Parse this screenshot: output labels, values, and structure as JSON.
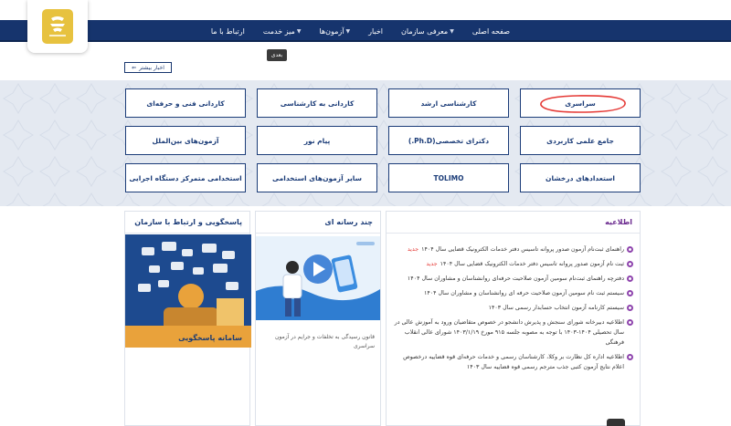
{
  "nav": {
    "items": [
      {
        "label": "صفحه اصلی",
        "dropdown": false
      },
      {
        "label": "معرفی سازمان",
        "dropdown": true
      },
      {
        "label": "اخبار",
        "dropdown": false
      },
      {
        "label": "آزمون‌ها",
        "dropdown": true
      },
      {
        "label": "میز خدمت",
        "dropdown": true
      },
      {
        "label": "ارتباط با ما",
        "dropdown": false
      }
    ]
  },
  "slider": {
    "next_label": "بعدی"
  },
  "news": {
    "more_label": "اخبار بیشتر"
  },
  "exams": [
    "سراسری",
    "کارشناسی ارشد",
    "کاردانی به کارشناسی",
    "کاردانی فنی و حرفه‌ای",
    "جامع علمی کاربردی",
    "دکترای تخصصی(Ph.D.)",
    "پیام نور",
    "آزمون‌های بین‌الملل",
    "استعدادهای درخشان",
    "TOLIMO",
    "سایر آزمون‌های استخدامی",
    "استخدامی متمرکز دستگاه اجرایی"
  ],
  "support": {
    "title": "پاسخگویی و ارتباط با سازمان",
    "image_label": "سامانه پاسخگویی"
  },
  "media": {
    "title": "چند رسانه ای",
    "caption": "قانون رسیدگی به تخلفات و جرایم در آزمون سراسری"
  },
  "notices": {
    "title": "اطلاعیه",
    "new_label": "جدید",
    "items": [
      {
        "text": "راهنمای ثبت‌نام آزمون صدور پروانه تاسیس دفتر خدمات الکترونیک قضایی سال ۱۴۰۴",
        "is_new": true
      },
      {
        "text": "ثبت نام آزمون صدور پروانه تاسیس دفتر خدمات الکترونیک قضایی سال ۱۴۰۴",
        "is_new": true
      },
      {
        "text": "دفترچه راهنمای ثبت‌نام سومین آزمون صلاحیت حرفه‌ای روانشناسان و مشاوران سال ۱۴۰۴",
        "is_new": false
      },
      {
        "text": "سیستم ثبت نام سومین آزمون صلاحیت حرفه ای روانشناسان و مشاوران سال ۱۴۰۴",
        "is_new": false
      },
      {
        "text": "سیستم کارنامه آزمون انتخاب حسابدار رسمی سال ۱۴۰۳",
        "is_new": false
      },
      {
        "text": "اطلاعیه دبیرخانه شورای سنجش و پذیرش دانشجو در خصوص متقاضیان ورود به آموزش عالی در سال تحصیلی ۱۴۰۴-۱۴۰۳ با توجه به مصوبه جلسه ۹۱۵ مورخ ۱۴۰۳/۱/۱۹ شورای عالی انقلاب فرهنگی",
        "is_new": false
      },
      {
        "text": "اطلاعیه اداره کل نظارت بر وکلا، کارشناسان رسمی و خدمات حرفه‌ای قوه قضاییه درخصوص اعلام نتایج آزمون کتبی جذب مترجم رسمی قوه قضاییه سال ۱۴۰۳",
        "is_new": false
      }
    ]
  },
  "colors": {
    "primary": "#16346d",
    "accent": "#8e44ad",
    "new_badge": "#e53935",
    "highlight": "#e53935"
  }
}
